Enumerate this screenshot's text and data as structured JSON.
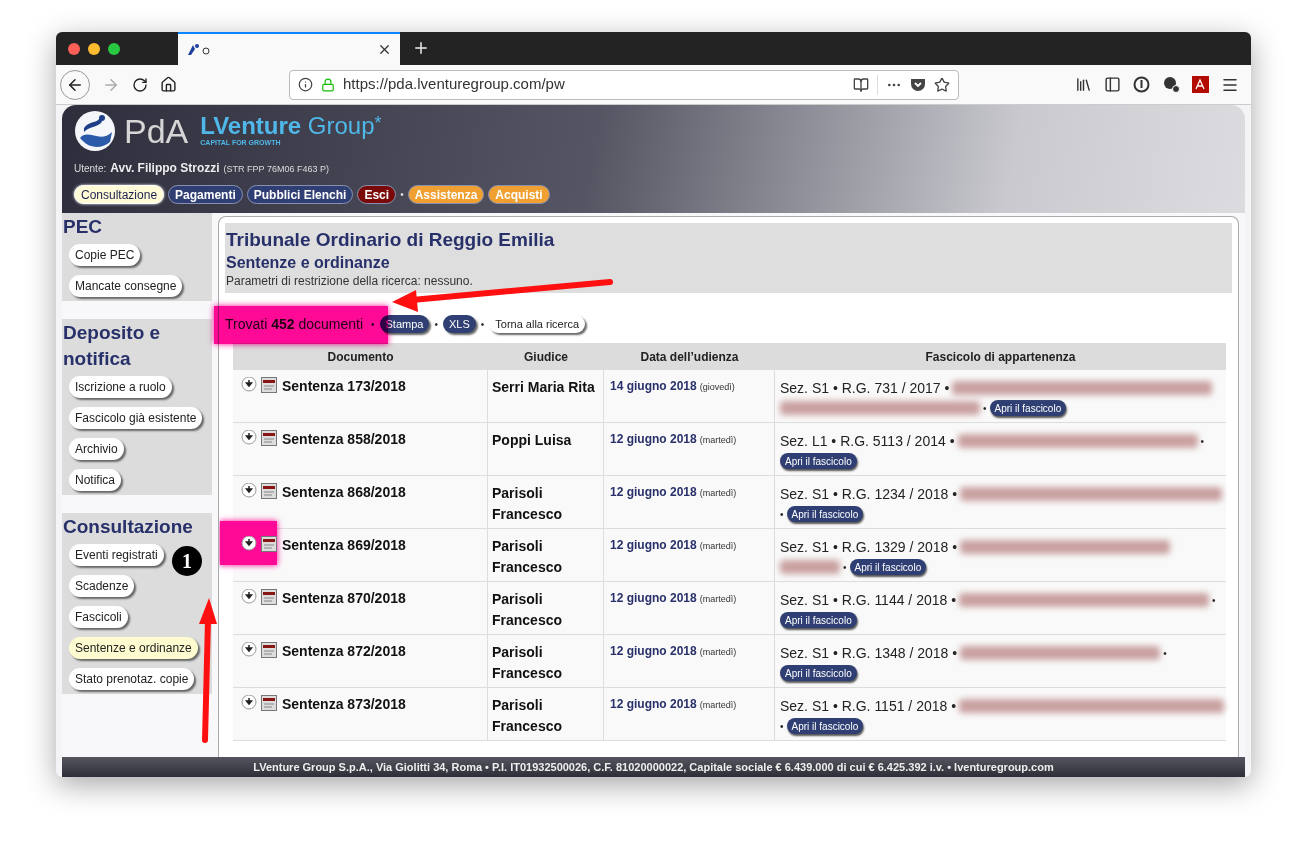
{
  "browser": {
    "url": "https://pda.lventuregroup.com/pw"
  },
  "header": {
    "brand": {
      "pda": "PdA",
      "name_bold": "LVenture",
      "name_light": "Group",
      "mark": "*",
      "tagline": "CAPITAL FOR GROWTH"
    },
    "user": {
      "label": "Utente:",
      "name": "Avv. Filippo Strozzi",
      "code": "(STR FPP 76M06 F463 P)"
    },
    "nav": [
      {
        "label": "Consultazione",
        "kind": "pill",
        "color": "#fffbd6",
        "selected": true
      },
      {
        "label": "Pagamenti",
        "kind": "pill",
        "color": "#2f3f73",
        "selected": false
      },
      {
        "label": "Pubblici Elenchi",
        "kind": "pill",
        "color": "#2f3f73",
        "selected": false
      },
      {
        "label": "Esci",
        "kind": "pill",
        "color": "#7a0a0a",
        "selected": false
      },
      {
        "label": "•",
        "kind": "separator"
      },
      {
        "label": "Assistenza",
        "kind": "pill",
        "color": "#f0a030",
        "selected": false
      },
      {
        "label": "Acquisti",
        "kind": "pill",
        "color": "#f0a030",
        "selected": false
      }
    ]
  },
  "sidebar": [
    {
      "title": "PEC",
      "items": [
        {
          "label": "Copie PEC",
          "selected": false
        },
        {
          "label": "Mancate consegne",
          "selected": false
        }
      ]
    },
    {
      "title": "Deposito e notifica",
      "items": [
        {
          "label": "Iscrizione a ruolo",
          "selected": false
        },
        {
          "label": "Fascicolo già esistente",
          "selected": false
        },
        {
          "label": "Archivio",
          "selected": false
        },
        {
          "label": "Notifica",
          "selected": false
        }
      ]
    },
    {
      "title": "Consultazione",
      "items": [
        {
          "label": "Eventi registrati",
          "selected": false
        },
        {
          "label": "Scadenze",
          "selected": false
        },
        {
          "label": "Fascicoli",
          "selected": false
        },
        {
          "label": "Sentenze e ordinanze",
          "selected": true
        },
        {
          "label": "Stato prenotaz. copie",
          "selected": false
        }
      ]
    }
  ],
  "main": {
    "title": "Tribunale Ordinario di Reggio Emilia",
    "subtitle": "Sentenze e ordinanze",
    "params": "Parametri di restrizione della ricerca: nessuno.",
    "results": {
      "text": "Trovati **452** documenti",
      "actions": [
        {
          "kind": "separator",
          "label": "•"
        },
        {
          "kind": "dark",
          "label": "Stampa"
        },
        {
          "kind": "separator",
          "label": "•"
        },
        {
          "kind": "dark",
          "label": "XLS"
        },
        {
          "kind": "separator",
          "label": "•"
        },
        {
          "kind": "light",
          "label": "Torna alla ricerca"
        }
      ]
    },
    "table": {
      "columns": [
        "Documento",
        "Giudice",
        "Data dell’udienza",
        "Fascicolo di appartenenza"
      ],
      "rows": [
        {
          "document": "Sentenza 173/2018",
          "judge": "Serri Maria Rita",
          "date": "14 giugno 2018",
          "weekday": "(giovedì)",
          "fascicolo": {
            "text": "Sez. S1 • R.G. 731 / 2017 •",
            "separator": "•",
            "button": "Apri il fascicolo"
          }
        },
        {
          "document": "Sentenza 858/2018",
          "judge": "Poppi Luisa",
          "date": "12 giugno 2018",
          "weekday": "(martedì)",
          "fascicolo": {
            "text": "Sez. L1 • R.G. 5113 / 2014 •",
            "separator": "•",
            "button": "Apri il fascicolo"
          }
        },
        {
          "document": "Sentenza 868/2018",
          "judge": "Parisoli Francesco",
          "date": "12 giugno 2018",
          "weekday": "(martedì)",
          "fascicolo": {
            "text": "Sez. S1 • R.G. 1234 / 2018 •",
            "separator": "•",
            "button": "Apri il fascicolo"
          }
        },
        {
          "document": "Sentenza 869/2018",
          "judge": "Parisoli Francesco",
          "date": "12 giugno 2018",
          "weekday": "(martedì)",
          "fascicolo": {
            "text": "Sez. S1 • R.G. 1329 / 2018 •",
            "separator": "•",
            "button": "Apri il fascicolo"
          }
        },
        {
          "document": "Sentenza 870/2018",
          "judge": "Parisoli Francesco",
          "date": "12 giugno 2018",
          "weekday": "(martedì)",
          "fascicolo": {
            "text": "Sez. S1 • R.G. 1144 / 2018 •",
            "separator": "•",
            "button": "Apri il fascicolo"
          }
        },
        {
          "document": "Sentenza 872/2018",
          "judge": "Parisoli Francesco",
          "date": "12 giugno 2018",
          "weekday": "(martedì)",
          "fascicolo": {
            "text": "Sez. S1 • R.G. 1348 / 2018 •",
            "separator": "•",
            "button": "Apri il fascicolo"
          }
        },
        {
          "document": "Sentenza 873/2018",
          "judge": "Parisoli Francesco",
          "date": "12 giugno 2018",
          "weekday": "(martedì)",
          "fascicolo": {
            "text": "Sez. S1 • R.G. 1151 / 2018 •",
            "separator": "•",
            "button": "Apri il fascicolo"
          }
        }
      ]
    }
  },
  "footer": "LVenture Group S.p.A., Via Giolitti 34, Roma • P.I. IT01932500026, C.F. 81020000022, Capitale sociale € 6.439.000 di cui € 6.425.392 i.v. • lventuregroup.com",
  "annotations": {
    "badge": "1"
  }
}
